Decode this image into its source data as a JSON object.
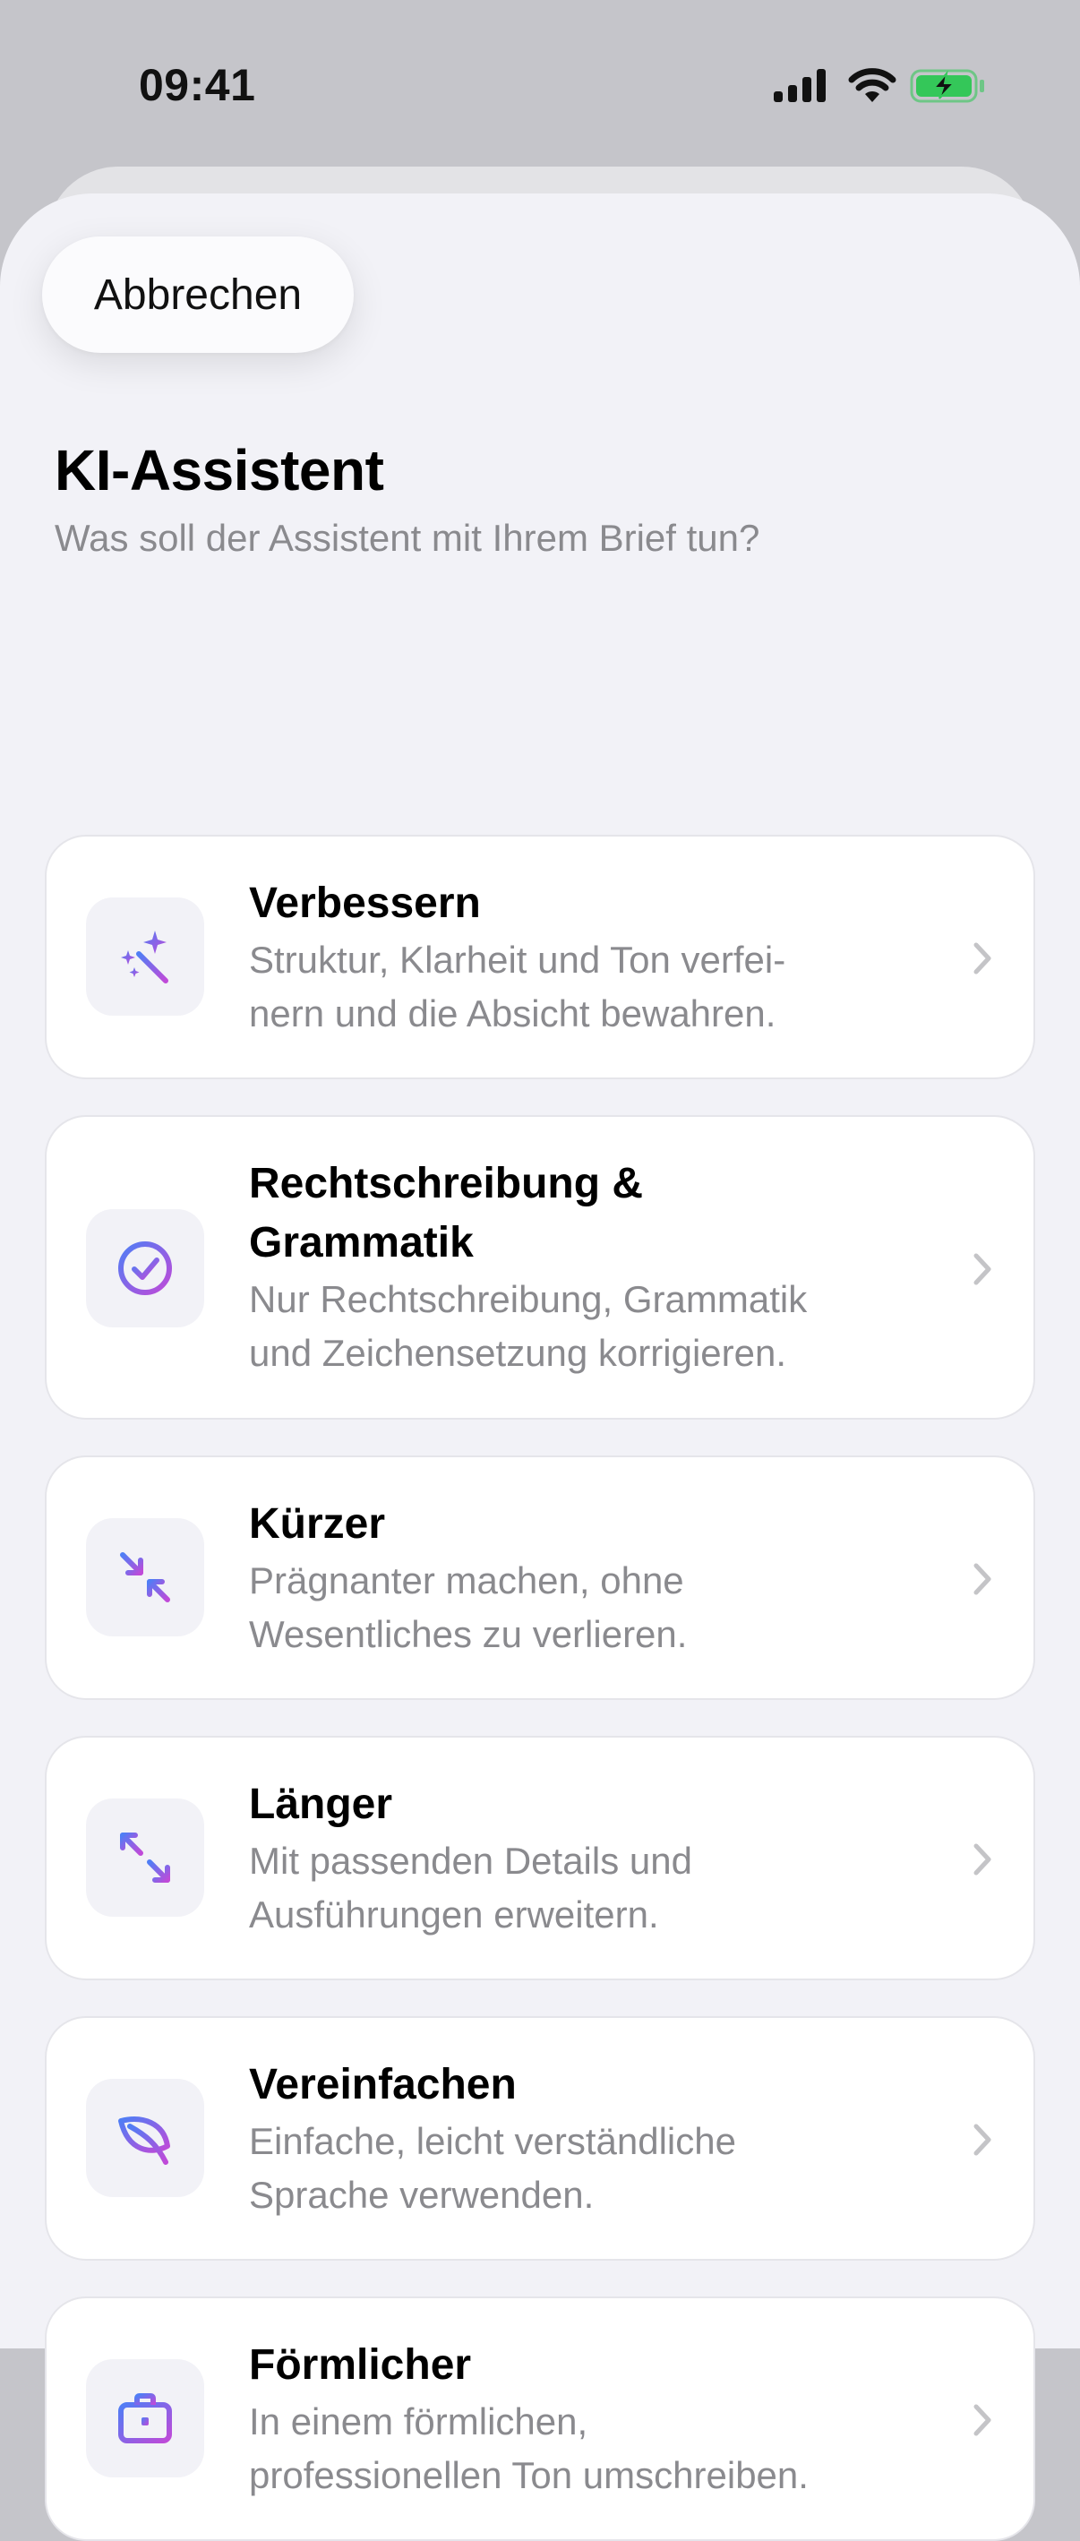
{
  "status_bar": {
    "time": "09:41",
    "icons": [
      "signal-icon",
      "wifi-icon",
      "battery-charging-icon"
    ],
    "battery_color": "#34c759"
  },
  "header": {
    "cancel_label": "Abbrechen",
    "title": "KI-Assistent",
    "subtitle": "Was soll der Assistent mit Ihrem Brief tun?"
  },
  "accent": {
    "gradient_start": "#4f7ef5",
    "gradient_end": "#c04ad8"
  },
  "options": [
    {
      "icon": "magic-wand-sparkles-icon",
      "title": "Verbessern",
      "description_lines": [
        "Struktur, Klarheit und Ton verfei-",
        "nern und die Absicht bewahren."
      ]
    },
    {
      "icon": "checkmark-circle-icon",
      "title_lines": [
        "Rechtschreibung &",
        "Grammatik"
      ],
      "description_lines": [
        "Nur Rechtschreibung, Grammatik",
        "und Zeichensetzung korrigieren."
      ]
    },
    {
      "icon": "arrows-inward-icon",
      "title": "Kürzer",
      "description_lines": [
        "Prägnanter machen, ohne",
        "Wesentliches zu verlieren."
      ]
    },
    {
      "icon": "arrows-outward-icon",
      "title": "Länger",
      "description_lines": [
        "Mit passenden Details und",
        "Ausführungen erweitern."
      ]
    },
    {
      "icon": "leaf-icon",
      "title": "Vereinfachen",
      "description_lines": [
        "Einfache, leicht verständliche",
        "Sprache verwenden."
      ]
    },
    {
      "icon": "briefcase-icon",
      "title": "Förmlicher",
      "description_lines": [
        "In einem förmlichen,",
        "professionellen Ton umschreiben."
      ]
    }
  ]
}
